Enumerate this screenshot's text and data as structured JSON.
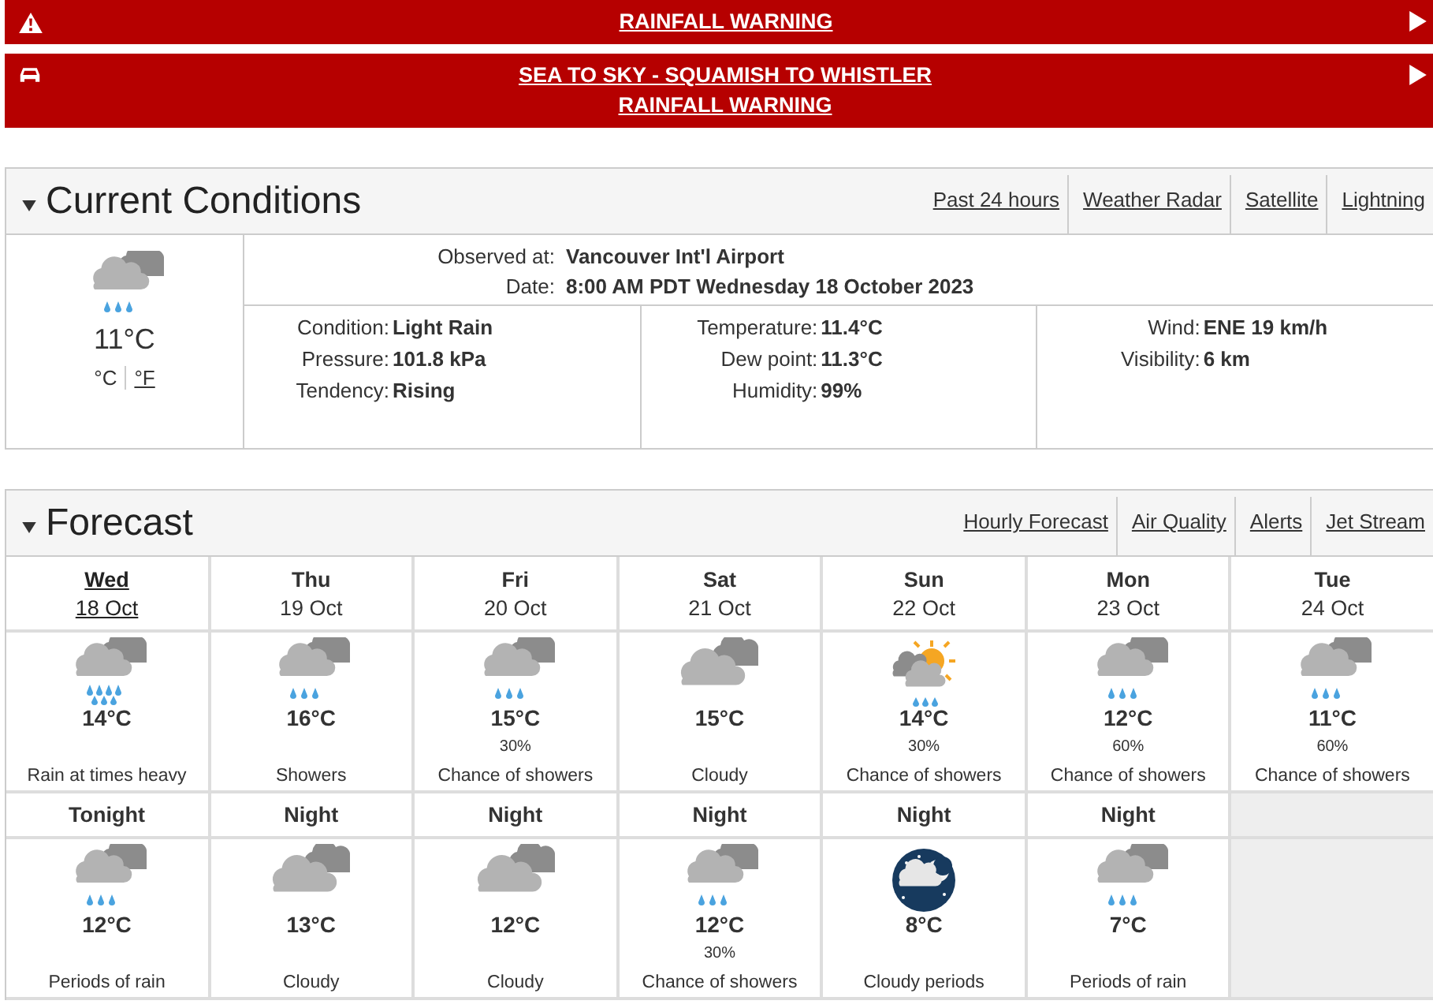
{
  "alerts": [
    {
      "kind": "warning",
      "lines": [
        "RAINFALL WARNING"
      ]
    },
    {
      "kind": "car",
      "lines": [
        "SEA TO SKY - SQUAMISH TO WHISTLER",
        "RAINFALL WARNING"
      ]
    }
  ],
  "current_conditions": {
    "title": "Current Conditions",
    "expanded": true,
    "links": [
      "Past 24 hours",
      "Weather Radar",
      "Satellite",
      "Lightning"
    ],
    "kind": "rain",
    "temperature": "11°C",
    "units": [
      {
        "label": "°C",
        "selected": true
      },
      {
        "label": "°F",
        "selected": false
      }
    ],
    "station": [
      {
        "label": "Observed at:",
        "value": "Vancouver Int'l Airport"
      },
      {
        "label": "Date:",
        "value": "8:00 AM PDT Wednesday 18 October 2023"
      }
    ],
    "columns": [
      [
        {
          "label": "Condition:",
          "value": "Light Rain"
        },
        {
          "label": "Pressure:",
          "value": "101.8 kPa"
        },
        {
          "label": "Tendency:",
          "value": "Rising"
        }
      ],
      [
        {
          "label": "Temperature:",
          "value": "11.4°C"
        },
        {
          "label": "Dew point:",
          "value": "11.3°C"
        },
        {
          "label": "Humidity:",
          "value": "99%"
        }
      ],
      [
        {
          "label": "Wind:",
          "value": "ENE 19 km/h"
        },
        {
          "label": "Visibility:",
          "value": "6 km"
        }
      ]
    ]
  },
  "forecast": {
    "title": "Forecast",
    "expanded": true,
    "links": [
      "Hourly Forecast",
      "Air Quality",
      "Alerts",
      "Jet Stream"
    ],
    "days": [
      {
        "day": "Wed",
        "date": "18 Oct",
        "selected": true,
        "kind": "heavy-rain",
        "temp": "14°C",
        "summary": "Rain at times heavy"
      },
      {
        "day": "Thu",
        "date": "19 Oct",
        "selected": false,
        "kind": "rain",
        "temp": "16°C",
        "summary": "Showers"
      },
      {
        "day": "Fri",
        "date": "20 Oct",
        "selected": false,
        "kind": "rain",
        "temp": "15°C",
        "pop": "30%",
        "summary": "Chance of showers"
      },
      {
        "day": "Sat",
        "date": "21 Oct",
        "selected": false,
        "kind": "cloudy",
        "temp": "15°C",
        "summary": "Cloudy"
      },
      {
        "day": "Sun",
        "date": "22 Oct",
        "selected": false,
        "kind": "sun-rain",
        "temp": "14°C",
        "pop": "30%",
        "summary": "Chance of showers"
      },
      {
        "day": "Mon",
        "date": "23 Oct",
        "selected": false,
        "kind": "rain",
        "temp": "12°C",
        "pop": "60%",
        "summary": "Chance of showers"
      },
      {
        "day": "Tue",
        "date": "24 Oct",
        "selected": false,
        "kind": "rain",
        "temp": "11°C",
        "pop": "60%",
        "summary": "Chance of showers"
      }
    ],
    "nights": [
      {
        "label": "Tonight",
        "kind": "rain",
        "temp": "12°C",
        "summary": "Periods of rain"
      },
      {
        "label": "Night",
        "kind": "cloudy",
        "temp": "13°C",
        "summary": "Cloudy"
      },
      {
        "label": "Night",
        "kind": "cloudy",
        "temp": "12°C",
        "summary": "Cloudy"
      },
      {
        "label": "Night",
        "kind": "rain",
        "temp": "12°C",
        "pop": "30%",
        "summary": "Chance of showers"
      },
      {
        "label": "Night",
        "kind": "night-cloud",
        "temp": "8°C",
        "summary": "Cloudy periods"
      },
      {
        "label": "Night",
        "kind": "rain",
        "temp": "7°C",
        "summary": "Periods of rain"
      }
    ]
  }
}
